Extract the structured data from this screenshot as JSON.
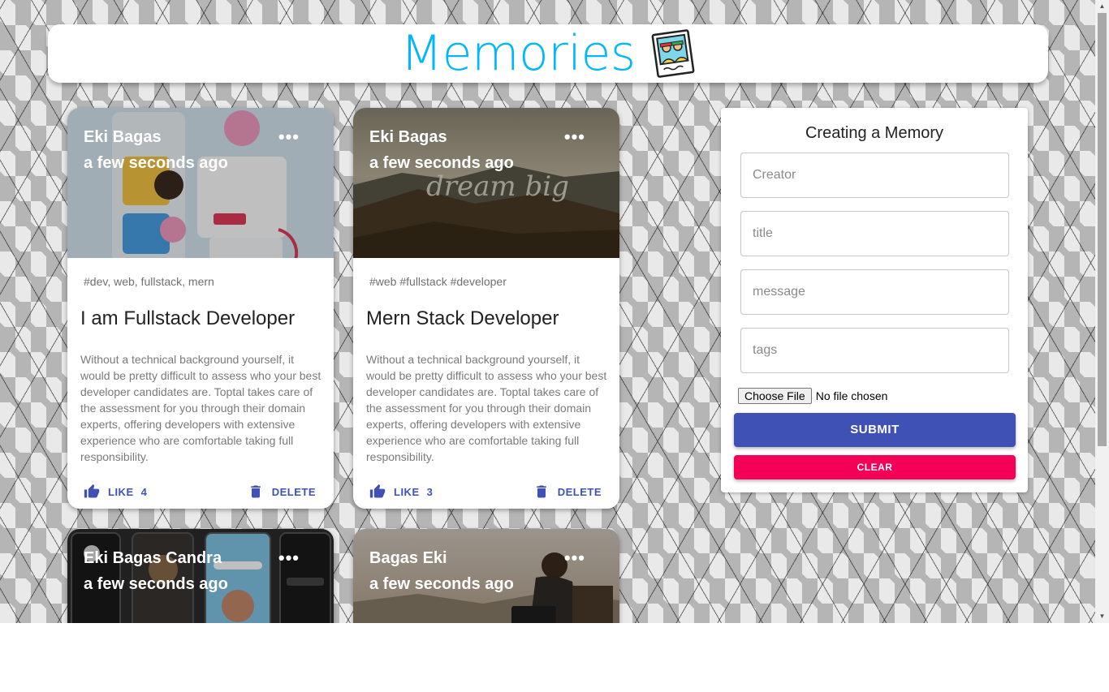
{
  "app": {
    "title": "Memories",
    "accent_color": "#00b7ff",
    "logo_icon": "polaroid-photo-icon"
  },
  "posts": [
    {
      "creator": "Eki Bagas",
      "time": "a few seconds ago",
      "tags": "#dev, web, fullstack, mern",
      "title": "I am Fullstack Developer",
      "message": "Without a technical background yourself, it would be pretty difficult to assess who your best developer candidates are. Toptal takes care of the assessment for you through their domain experts, offering developers with extensive experience who are comfortable taking full responsibility.",
      "like_label": "LIKE",
      "like_count": "4",
      "delete_label": "DELETE",
      "image": "app-ui-design-image"
    },
    {
      "creator": "Eki Bagas",
      "time": "a few seconds ago",
      "tags": "#web #fullstack #developer",
      "title": "Mern Stack Developer",
      "message": "Without a technical background yourself, it would be pretty difficult to assess who your best developer candidates are. Toptal takes care of the assessment for you through their domain experts, offering developers with extensive experience who are comfortable taking full responsibility.",
      "like_label": "LIKE",
      "like_count": "3",
      "delete_label": "DELETE",
      "image": "dream-big-mountain-image",
      "image_text": "dream big"
    },
    {
      "creator": "Eki Bagas Candra",
      "time": "a few seconds ago",
      "image": "mobile-app-screens-image"
    },
    {
      "creator": "Bagas Eki",
      "time": "a few seconds ago",
      "image": "woman-laptop-outdoor-image"
    }
  ],
  "form": {
    "title": "Creating a Memory",
    "fields": {
      "creator": "Creator",
      "title": "title",
      "message": "message",
      "tags": "tags"
    },
    "file_button": "Choose File",
    "file_status": "No file chosen",
    "submit_label": "SUBMIT",
    "clear_label": "CLEAR",
    "submit_color": "#3f51b5",
    "clear_color": "#f50057"
  }
}
